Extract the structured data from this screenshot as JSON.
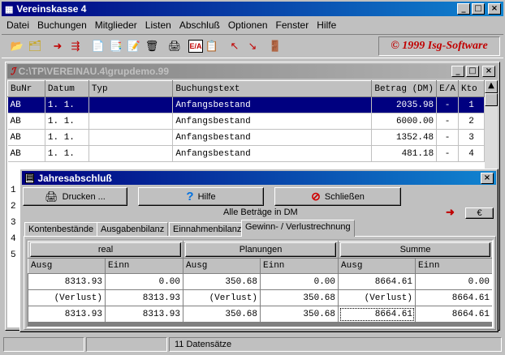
{
  "app": {
    "title": "Vereinskasse 4"
  },
  "menu": [
    "Datei",
    "Buchungen",
    "Mitglieder",
    "Listen",
    "Abschluß",
    "Optionen",
    "Fenster",
    "Hilfe"
  ],
  "toolbar": {
    "copyright": "© 1999 Isg-Software"
  },
  "child": {
    "title": "C:\\TP\\VEREINAU.4\\grupdemo.99",
    "columns": [
      "BuNr",
      "Datum",
      "Typ",
      "Buchungstext",
      "Betrag (DM)",
      "E/A",
      "Kto"
    ],
    "rows": [
      [
        "AB",
        "1. 1.",
        "",
        "Anfangsbestand",
        "2035.98",
        "-",
        "1"
      ],
      [
        "AB",
        "1. 1.",
        "",
        "Anfangsbestand",
        "6000.00",
        "-",
        "2"
      ],
      [
        "AB",
        "1. 1.",
        "",
        "Anfangsbestand",
        "1352.48",
        "-",
        "3"
      ],
      [
        "AB",
        "1. 1.",
        "",
        "Anfangsbestand",
        "481.18",
        "-",
        "4"
      ]
    ],
    "partial_rows": [
      "1",
      "2",
      "3",
      "4",
      "5"
    ]
  },
  "dialog": {
    "title": "Jahresabschluß",
    "print_label": "Drucken ...",
    "help_label": "Hilfe",
    "close_label": "Schließen",
    "currency_note": "Alle Beträge in DM",
    "currency_button": "€",
    "tabs": [
      "Kontenbestände",
      "Ausgabenbilanz",
      "Einnahmenbilanz",
      "Gewinn- / Verlustrechnung"
    ],
    "groups": [
      "real",
      "Planungen",
      "Summe"
    ],
    "subcols": [
      "Ausg",
      "Einn",
      "Ausg",
      "Einn",
      "Ausg",
      "Einn"
    ],
    "rows": [
      [
        "8313.93",
        "0.00",
        "350.68",
        "0.00",
        "8664.61",
        "0.00"
      ],
      [
        "(Verlust)",
        "8313.93",
        "(Verlust)",
        "350.68",
        "(Verlust)",
        "8664.61"
      ],
      [
        "8313.93",
        "8313.93",
        "350.68",
        "350.68",
        "8664.61",
        "8664.61"
      ]
    ]
  },
  "status": {
    "records": "11 Datensätze"
  }
}
